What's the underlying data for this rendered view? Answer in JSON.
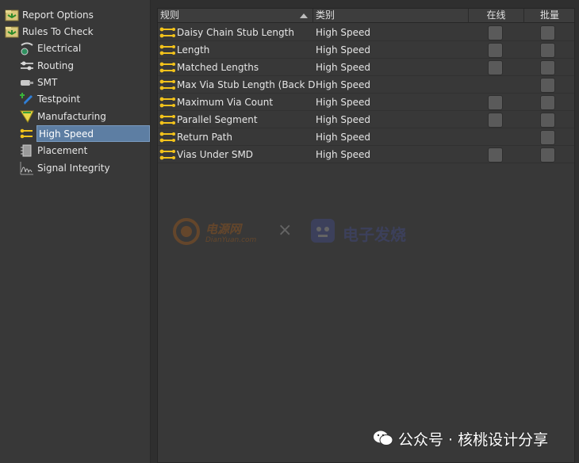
{
  "tree": {
    "items": [
      {
        "label": "Report Options",
        "icon": "rules-folder-icon",
        "level": 0
      },
      {
        "label": "Rules To Check",
        "icon": "rules-folder-icon",
        "level": 0
      },
      {
        "label": "Electrical",
        "icon": "electrical-icon",
        "level": 1
      },
      {
        "label": "Routing",
        "icon": "routing-icon",
        "level": 1
      },
      {
        "label": "SMT",
        "icon": "smt-icon",
        "level": 1
      },
      {
        "label": "Testpoint",
        "icon": "testpoint-icon",
        "level": 1
      },
      {
        "label": "Manufacturing",
        "icon": "manufacturing-icon",
        "level": 1
      },
      {
        "label": "High Speed",
        "icon": "high-speed-icon",
        "level": 1,
        "selected": true
      },
      {
        "label": "Placement",
        "icon": "placement-icon",
        "level": 1
      },
      {
        "label": "Signal Integrity",
        "icon": "signal-integrity-icon",
        "level": 1
      }
    ]
  },
  "grid": {
    "headers": {
      "rule": "规则",
      "category": "类别",
      "online": "在线",
      "batch": "批量"
    },
    "rows": [
      {
        "rule": "Daisy Chain Stub Length",
        "category": "High Speed",
        "online": true,
        "batch": true
      },
      {
        "rule": "Length",
        "category": "High Speed",
        "online": true,
        "batch": true
      },
      {
        "rule": "Matched Lengths",
        "category": "High Speed",
        "online": true,
        "batch": true
      },
      {
        "rule": "Max Via Stub Length (Back Drilling)",
        "category": "High Speed",
        "online": false,
        "batch": true
      },
      {
        "rule": "Maximum Via Count",
        "category": "High Speed",
        "online": true,
        "batch": true
      },
      {
        "rule": "Parallel Segment",
        "category": "High Speed",
        "online": true,
        "batch": true
      },
      {
        "rule": "Return Path",
        "category": "High Speed",
        "online": false,
        "batch": true
      },
      {
        "rule": "Vias Under SMD",
        "category": "High Speed",
        "online": true,
        "batch": true
      }
    ]
  },
  "watermark": {
    "logo1": "电源网",
    "logo1_sub": "DianYuan.com",
    "separator": "×",
    "logo2": "电子发烧",
    "wechat": "公众号 · 核桃设计分享"
  },
  "colors": {
    "selection": "#5d7ea3",
    "rule_icon": "#f2c21b",
    "checkbox": "#5a5a5a",
    "panel": "#383838"
  }
}
